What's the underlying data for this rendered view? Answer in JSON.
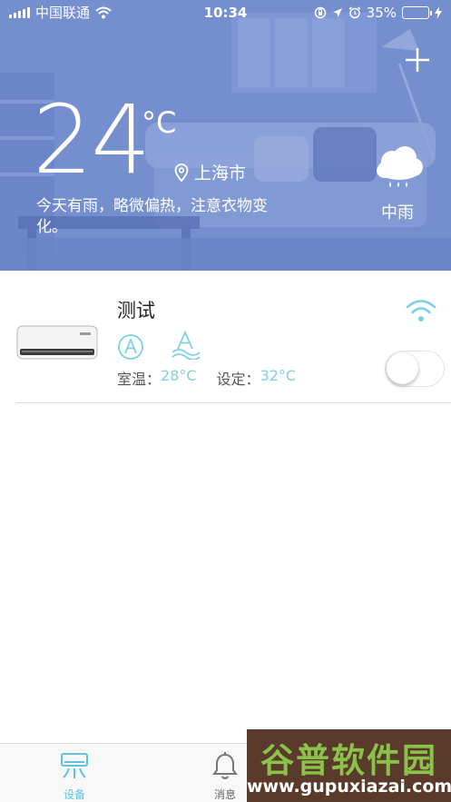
{
  "status_bar": {
    "carrier": "中国联通",
    "time": "10:34",
    "battery_percent": "35%",
    "battery_level": 0.35,
    "icons": [
      "signal-icon",
      "wifi-icon",
      "orientation-lock-icon",
      "location-arrow-icon",
      "alarm-icon",
      "battery-icon",
      "charging-icon"
    ]
  },
  "weather": {
    "temperature": "24",
    "unit": "°C",
    "city": "上海市",
    "advice": "今天有雨，略微偏热，注意衣物变化。",
    "condition": "中雨",
    "icon": "rain-cloud-icon"
  },
  "header": {
    "add_icon": "plus-icon"
  },
  "device": {
    "name": "测试",
    "image": "air-conditioner-image",
    "mode_icons": [
      "auto-mode-icon",
      "wind-mode-icon"
    ],
    "room_temp_label": "室温：",
    "room_temp_value": "28°C",
    "set_temp_label": "设定：",
    "set_temp_value": "32°C",
    "power_on": false,
    "accent_color": "#5ec3e3"
  },
  "tabbar": {
    "tabs": [
      {
        "label": "设备",
        "icon": "device-icon",
        "active": true
      },
      {
        "label": "消息",
        "icon": "bell-icon",
        "active": false
      }
    ]
  },
  "watermark": {
    "title": "谷普软件园",
    "url": "www.gupuxiazai.com"
  }
}
